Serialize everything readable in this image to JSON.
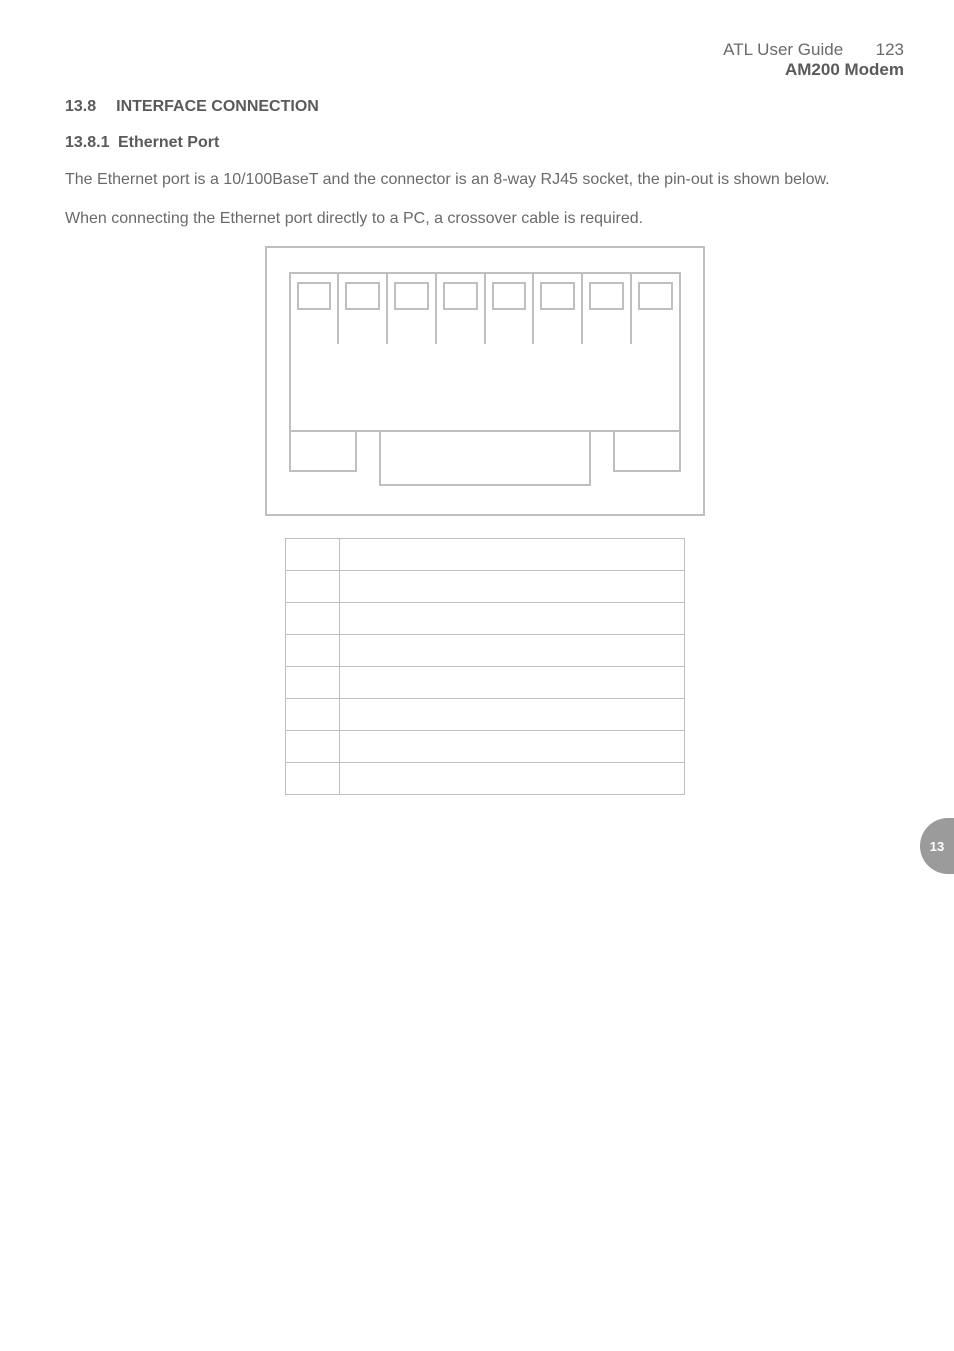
{
  "header": {
    "guide": "ATL User Guide",
    "page_number": "123",
    "product": "AM200 Modem"
  },
  "section": {
    "number": "13.8",
    "title": "INTERFACE CONNECTION"
  },
  "subsection": {
    "number": "13.8.1",
    "title": "Ethernet Port"
  },
  "paragraphs": {
    "p1": "The Ethernet port is a 10/100BaseT and the connector is an 8-way RJ45 socket, the pin-out is shown below.",
    "p2": "When connecting the Ethernet port directly to a PC, a crossover cable is required."
  },
  "side_tab": "13"
}
